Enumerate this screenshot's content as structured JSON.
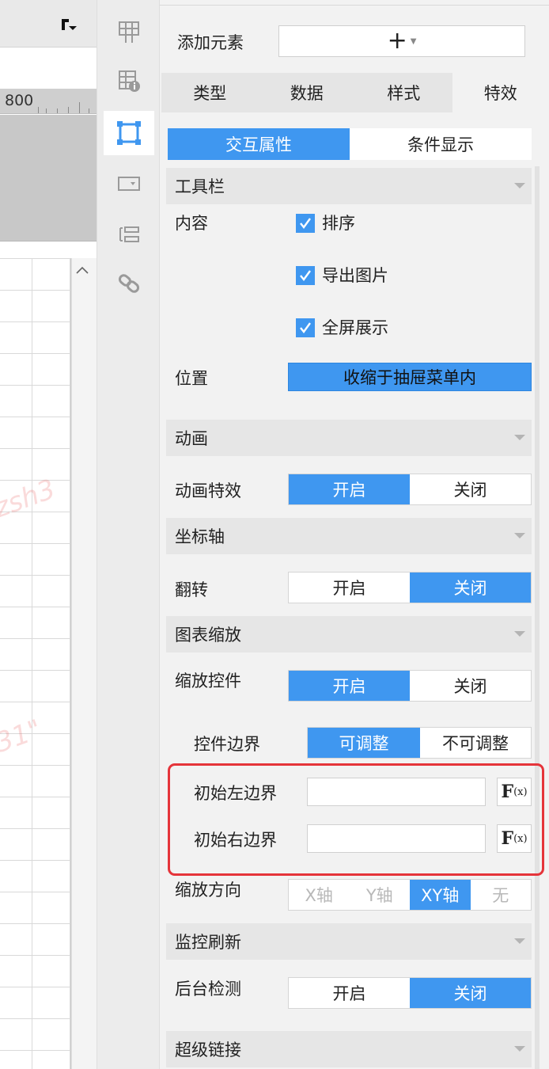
{
  "canvas": {
    "ruler_label": "800"
  },
  "panel": {
    "add_element_label": "添加元素",
    "add_button_icon": "plus-icon",
    "tabs": [
      {
        "label": "类型"
      },
      {
        "label": "数据"
      },
      {
        "label": "样式"
      },
      {
        "label": "特效",
        "active": true
      }
    ],
    "subtabs": [
      {
        "label": "交互属性",
        "active": true
      },
      {
        "label": "条件显示"
      }
    ],
    "toolbar": {
      "title": "工具栏",
      "content_label": "内容",
      "checkboxes": [
        {
          "label": "排序",
          "checked": true
        },
        {
          "label": "导出图片",
          "checked": true
        },
        {
          "label": "全屏展示",
          "checked": true
        }
      ],
      "position_label": "位置",
      "position_value": "收缩于抽屉菜单内"
    },
    "animation": {
      "title": "动画",
      "effect_label": "动画特效",
      "on": "开启",
      "off": "关闭",
      "selected": "开启"
    },
    "axis": {
      "title": "坐标轴",
      "flip_label": "翻转",
      "on": "开启",
      "off": "关闭",
      "selected": "关闭"
    },
    "zoom": {
      "title": "图表缩放",
      "control_label": "缩放控件",
      "on": "开启",
      "off": "关闭",
      "selected": "开启",
      "boundary_label": "控件边界",
      "adjustable": "可调整",
      "not_adjustable": "不可调整",
      "boundary_selected": "可调整",
      "init_left_label": "初始左边界",
      "init_left_value": "",
      "init_right_label": "初始右边界",
      "init_right_value": "",
      "direction_label": "缩放方向",
      "directions": [
        "X轴",
        "Y轴",
        "XY轴",
        "无"
      ],
      "direction_selected": "XY轴"
    },
    "monitor": {
      "title": "监控刷新",
      "bg_label": "后台检测",
      "on": "开启",
      "off": "关闭",
      "selected": "关闭"
    },
    "hyperlink": {
      "title": "超级链接"
    },
    "colors": {
      "accent": "#3f97f0",
      "highlight_box": "#e5343a"
    }
  }
}
